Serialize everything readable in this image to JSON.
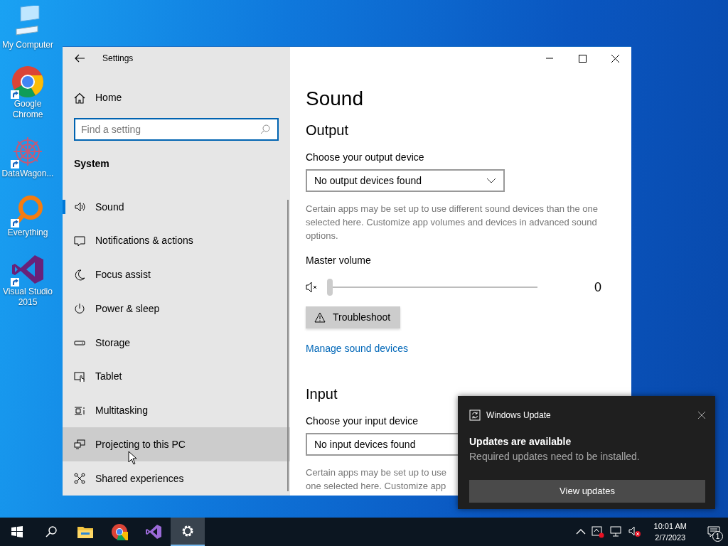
{
  "desktop_icons": [
    {
      "kind": "computer",
      "label": "My Computer",
      "shortcut": false
    },
    {
      "kind": "chrome",
      "label": "Google Chrome",
      "shortcut": true
    },
    {
      "kind": "flower",
      "label": "DataWagon...",
      "shortcut": true
    },
    {
      "kind": "magnifier",
      "label": "Everything",
      "shortcut": true
    },
    {
      "kind": "vs",
      "label": "Visual Studio 2015",
      "shortcut": true
    }
  ],
  "window": {
    "title": "Settings"
  },
  "sidebar": {
    "home": "Home",
    "search": {
      "placeholder": "Find a setting"
    },
    "section": "System",
    "items": [
      {
        "kind": "sound",
        "label": "Sound",
        "selected": true,
        "hovered": false
      },
      {
        "kind": "notifications",
        "label": "Notifications & actions",
        "selected": false,
        "hovered": false
      },
      {
        "kind": "focus",
        "label": "Focus assist",
        "selected": false,
        "hovered": false
      },
      {
        "kind": "power",
        "label": "Power & sleep",
        "selected": false,
        "hovered": false
      },
      {
        "kind": "storage",
        "label": "Storage",
        "selected": false,
        "hovered": false
      },
      {
        "kind": "tablet",
        "label": "Tablet",
        "selected": false,
        "hovered": false
      },
      {
        "kind": "multitasking",
        "label": "Multitasking",
        "selected": false,
        "hovered": false
      },
      {
        "kind": "projecting",
        "label": "Projecting to this PC",
        "selected": false,
        "hovered": true
      },
      {
        "kind": "shared",
        "label": "Shared experiences",
        "selected": false,
        "hovered": false
      }
    ]
  },
  "content": {
    "title": "Sound",
    "output": {
      "heading": "Output",
      "device_label": "Choose your output device",
      "device": "No output devices found",
      "note": "Certain apps may be set up to use different sound devices than the one selected here. Customize app volumes and devices in advanced sound options.",
      "volume_label": "Master volume",
      "volume": {
        "muted": true,
        "level": 0,
        "reading": "0"
      },
      "troubleshoot": "Troubleshoot",
      "link": "Manage sound devices"
    },
    "input": {
      "heading": "Input",
      "device_label": "Choose your input device",
      "device": "No input devices found",
      "note_lines": [
        "Certain apps may be set up to use",
        "one selected here. Customize app"
      ]
    }
  },
  "toast": {
    "app": "Windows Update",
    "title": "Updates are available",
    "body": "Required updates need to be installed.",
    "button": "View updates"
  },
  "taskbar": {
    "apps": [
      {
        "kind": "start",
        "selected": false
      },
      {
        "kind": "search",
        "selected": false
      },
      {
        "kind": "explorer",
        "selected": false
      },
      {
        "kind": "chrome",
        "selected": false
      },
      {
        "kind": "vs",
        "selected": false
      },
      {
        "kind": "settings",
        "selected": true
      }
    ],
    "clock": {
      "time": "10:01 AM",
      "date": "2/7/2023"
    },
    "notification_count": "1"
  }
}
